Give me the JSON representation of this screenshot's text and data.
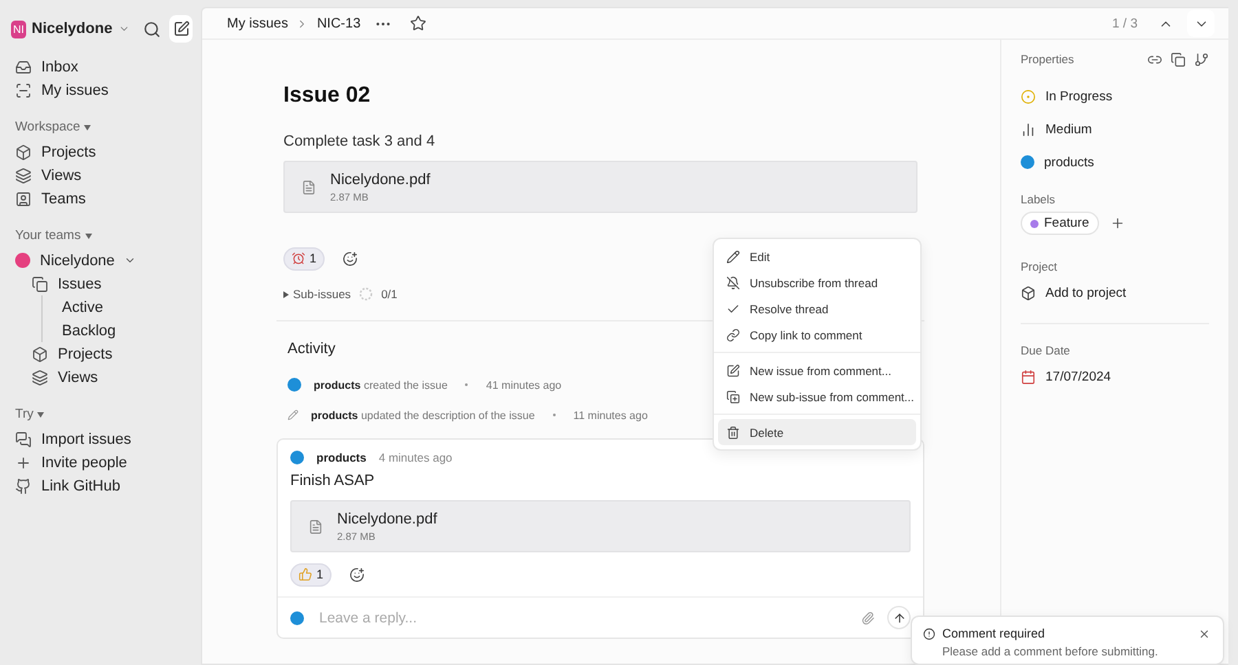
{
  "sidebar": {
    "workspace": {
      "initials": "NI",
      "name": "Nicelydone"
    },
    "top_items": [
      {
        "label": "Inbox"
      },
      {
        "label": "My issues"
      }
    ],
    "workspace_section": {
      "title": "Workspace",
      "items": [
        {
          "label": "Projects"
        },
        {
          "label": "Views"
        },
        {
          "label": "Teams"
        }
      ]
    },
    "teams_section": {
      "title": "Your teams",
      "team": {
        "label": "Nicelydone",
        "expanded": true,
        "children": [
          {
            "label": "Issues",
            "children": [
              {
                "label": "Active"
              },
              {
                "label": "Backlog"
              }
            ]
          },
          {
            "label": "Projects"
          },
          {
            "label": "Views"
          }
        ]
      }
    },
    "try_section": {
      "title": "Try",
      "items": [
        {
          "label": "Import issues"
        },
        {
          "label": "Invite people"
        },
        {
          "label": "Link GitHub"
        }
      ]
    }
  },
  "header": {
    "breadcrumbs": [
      "My issues",
      "NIC-13"
    ],
    "pager": "1 / 3"
  },
  "issue": {
    "title": "Issue 02",
    "description": "Complete task 3 and 4",
    "attachment": {
      "name": "Nicelydone.pdf",
      "size": "2.87 MB"
    },
    "reaction_count": "1",
    "sub_issues": {
      "label": "Sub-issues",
      "progress": "0/1",
      "level": 0
    }
  },
  "activity": {
    "title": "Activity",
    "events": [
      {
        "kind": "created",
        "actor": "products",
        "text": "created the issue",
        "time": "41 minutes ago"
      },
      {
        "kind": "updated",
        "actor": "products",
        "text": "updated the description of the issue",
        "time": "11 minutes ago"
      }
    ],
    "comment": {
      "author": "products",
      "time": "4 minutes ago",
      "body": "Finish ASAP",
      "attachment": {
        "name": "Nicelydone.pdf",
        "size": "2.87 MB"
      },
      "reaction_count": "1",
      "reply_placeholder": "Leave a reply..."
    }
  },
  "context_menu": {
    "groups": [
      [
        {
          "label": "Edit",
          "selected": false
        },
        {
          "label": "Unsubscribe from thread",
          "selected": false
        },
        {
          "label": "Resolve thread",
          "selected": false
        },
        {
          "label": "Copy link to comment",
          "selected": false
        }
      ],
      [
        {
          "label": "New issue from comment...",
          "selected": false
        },
        {
          "label": "New sub-issue from comment...",
          "selected": false
        }
      ],
      [
        {
          "label": "Delete",
          "selected": true
        }
      ]
    ]
  },
  "properties": {
    "title": "Properties",
    "status": "In Progress",
    "priority": "Medium",
    "assignee": "products",
    "labels_title": "Labels",
    "labels": [
      {
        "label": "Feature",
        "color": "#a77bea"
      }
    ],
    "project_title": "Project",
    "project": "Add to project",
    "due_title": "Due Date",
    "due": "17/07/2024"
  },
  "toast": {
    "title": "Comment required",
    "message": "Please add a comment before submitting."
  }
}
